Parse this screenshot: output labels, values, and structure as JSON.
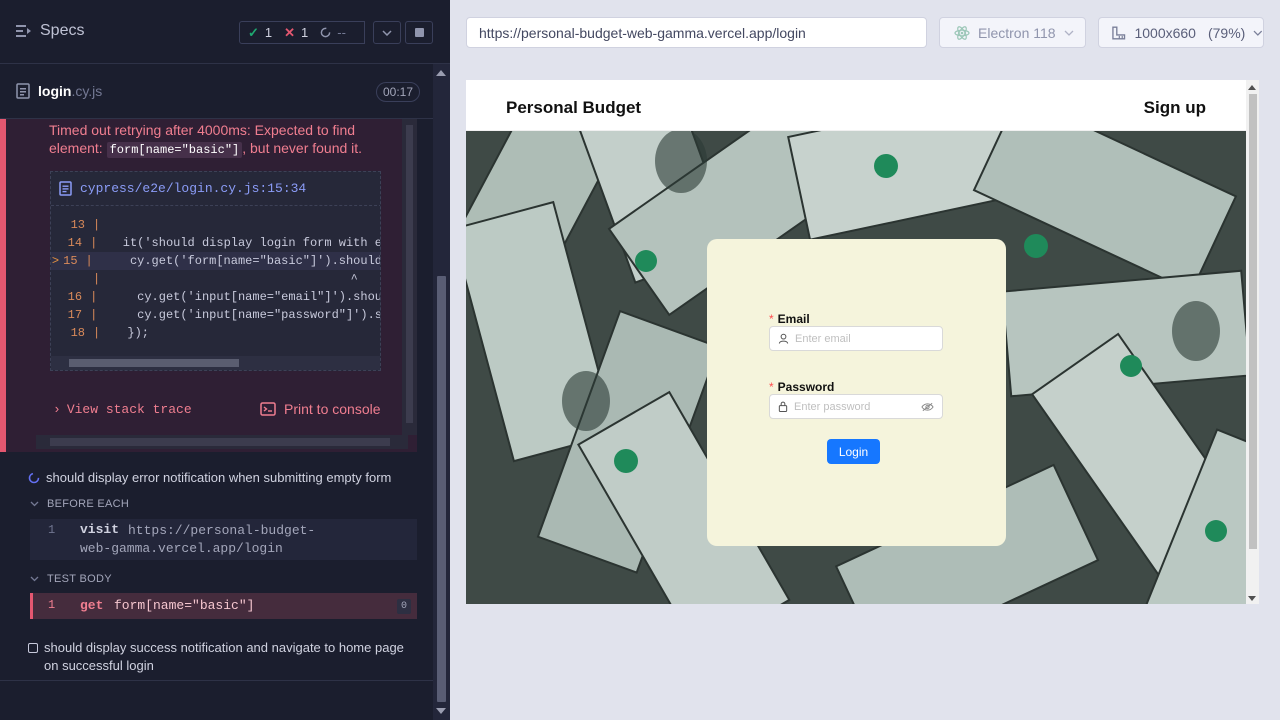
{
  "reporter": {
    "specs_label": "Specs",
    "stats": {
      "passed": "1",
      "failed": "1",
      "pending": "--"
    },
    "spec": {
      "name": "login",
      "ext": ".cy.js",
      "duration": "00:17"
    },
    "error": {
      "message_before": "Timed out retrying after 4000ms: Expected to find element:",
      "selector": "form[name=\"basic\"]",
      "message_after": ", but never found it.",
      "file_link": "cypress/e2e/login.cy.js:15:34",
      "code_lines": [
        {
          "num": "13",
          "marker": "",
          "code": ""
        },
        {
          "num": "14",
          "marker": "",
          "code": "  it('should display login form with e"
        },
        {
          "num": "15",
          "marker": ">",
          "code": "    cy.get('form[name=\"basic\"]').should"
        },
        {
          "num": "",
          "marker": "",
          "code": "                                 ^"
        },
        {
          "num": "16",
          "marker": "",
          "code": "    cy.get('input[name=\"email\"]').shou"
        },
        {
          "num": "17",
          "marker": "",
          "code": "    cy.get('input[name=\"password\"]').s"
        },
        {
          "num": "18",
          "marker": "",
          "code": "  });"
        }
      ],
      "view_stack": "View stack trace",
      "print_console": "Print to console"
    },
    "tests": {
      "running": "should display error notification when submitting empty form",
      "before_each_label": "BEFORE EACH",
      "before_each_cmd": {
        "num": "1",
        "name": "visit",
        "arg": "https://personal-budget-web-gamma.vercel.app/login"
      },
      "test_body_label": "TEST BODY",
      "test_body_cmd": {
        "num": "1",
        "name": "get",
        "arg": "form[name=\"basic\"]",
        "count": "0"
      },
      "pending": "should display success notification and navigate to home page on successful login"
    }
  },
  "browser": {
    "url": "https://personal-budget-web-gamma.vercel.app/login",
    "browser_name": "Electron 118",
    "viewport": "1000x660",
    "zoom": "(79%)"
  },
  "app": {
    "brand": "Personal Budget",
    "signup": "Sign up",
    "form": {
      "email_label": "Email",
      "email_placeholder": "Enter email",
      "password_label": "Password",
      "password_placeholder": "Enter password",
      "login_button": "Login"
    }
  },
  "colors": {
    "reporter_bg": "#1b1e2e",
    "error_red": "#e45770",
    "primary_blue": "#1677ff",
    "card_bg": "#f5f4dc"
  }
}
